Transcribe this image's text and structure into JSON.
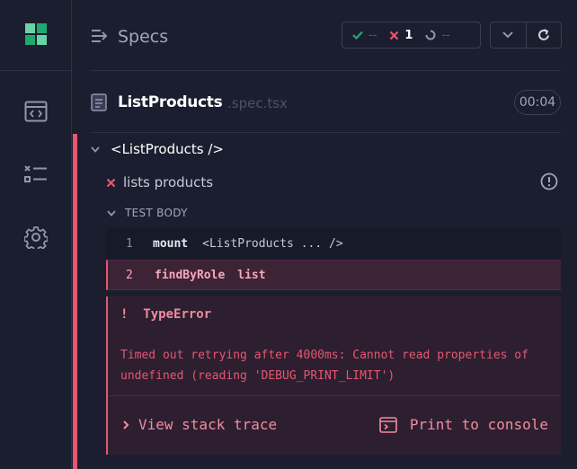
{
  "sidebar": {
    "logo": "cypress-logo",
    "items": [
      {
        "icon": "code-window-icon"
      },
      {
        "icon": "checklist-icon"
      },
      {
        "icon": "gear-icon"
      }
    ]
  },
  "header": {
    "title": "Specs",
    "stats": {
      "passed": "--",
      "failed": "1",
      "pending": "--"
    }
  },
  "spec": {
    "name": "ListProducts",
    "ext": ".spec.tsx",
    "duration": "00:04"
  },
  "runner": {
    "suite": "<ListProducts />",
    "test": "lists products",
    "section": "TEST BODY",
    "commands": [
      {
        "num": "1",
        "name": "mount",
        "arg": "<ListProducts ... />"
      },
      {
        "num": "2",
        "name": "findByRole",
        "arg": "list"
      }
    ],
    "error": {
      "marker": "!",
      "type": "TypeError",
      "message": "Timed out retrying after 4000ms: Cannot read properties of undefined (reading 'DEBUG_PRINT_LIMIT')",
      "stack_label": "View stack trace",
      "print_label": "Print to console"
    }
  },
  "colors": {
    "background": "#1b1e2e",
    "fail": "#e45770",
    "pass": "#1fa971",
    "accent_green": "#69d3a7"
  }
}
